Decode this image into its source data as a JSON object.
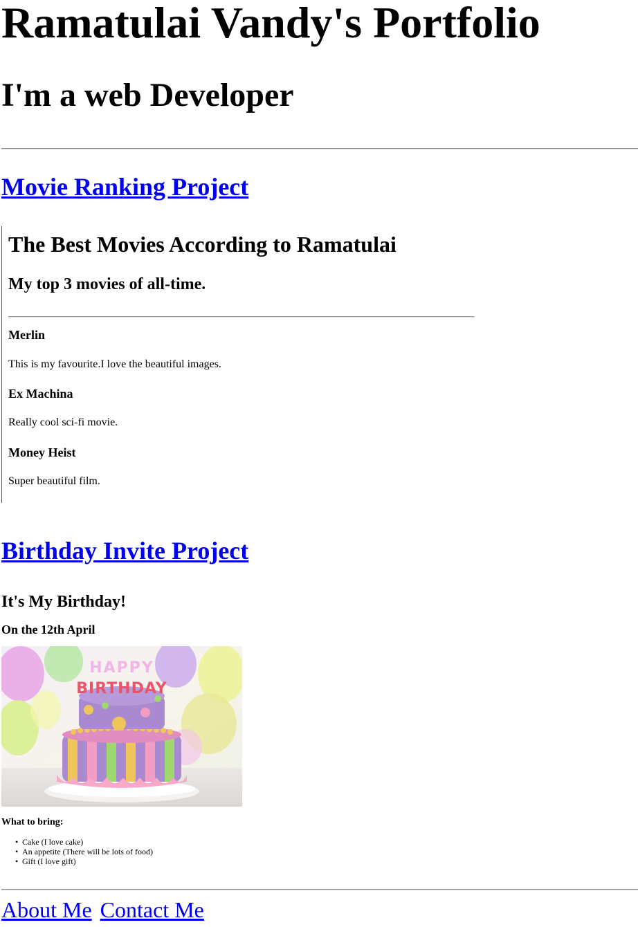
{
  "header": {
    "title": "Ramatulai Vandy's Portfolio",
    "subtitle": "I'm a web Developer"
  },
  "projects": {
    "movie": {
      "link_label": "Movie Ranking Project",
      "frame": {
        "title": "The Best Movies According to Ramatulai",
        "subtitle": "My top 3 movies of all-time.",
        "movies": [
          {
            "title": "Merlin",
            "description": "This is my favourite.I love the beautiful images."
          },
          {
            "title": "Ex Machina",
            "description": "Really cool sci-fi movie."
          },
          {
            "title": "Money Heist",
            "description": "Super beautiful film."
          }
        ]
      }
    },
    "birthday": {
      "link_label": "Birthday Invite Project",
      "frame": {
        "title": "It's My Birthday!",
        "date": "On the 12th April",
        "image_text_top": "HAPPY",
        "image_text_bottom": "BIRTHDAY",
        "bring_label": "What to bring:",
        "items": [
          "Cake (I love cake)",
          "An appetite (There will be lots of food)",
          "Gift (I love gift)"
        ]
      }
    }
  },
  "footer": {
    "about_label": "About Me",
    "contact_label": "Contact Me"
  },
  "colors": {
    "link": "#0000ee",
    "text": "#000000",
    "background": "#ffffff"
  }
}
